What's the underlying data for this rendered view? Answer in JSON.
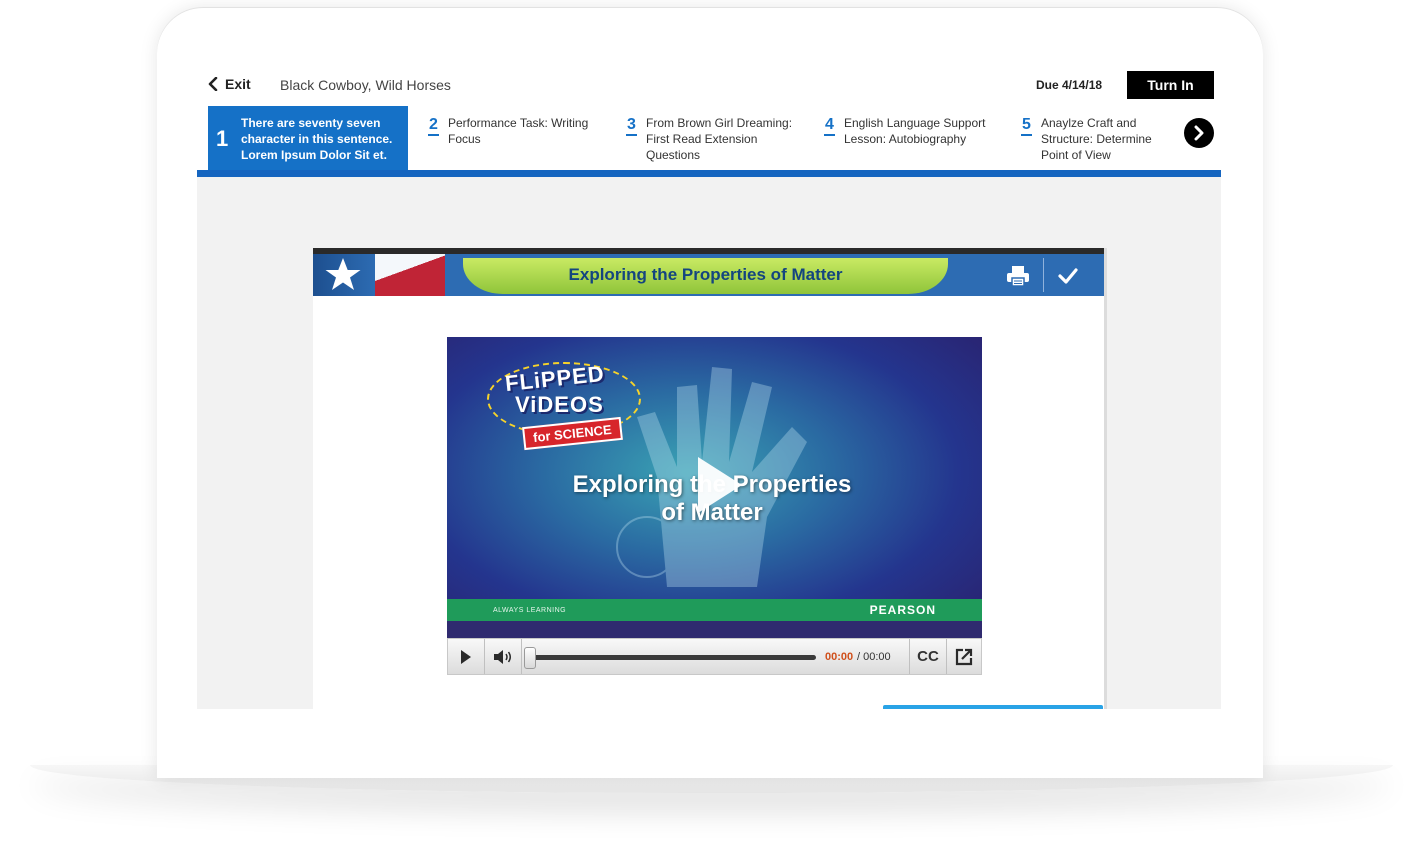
{
  "header": {
    "exit_label": "Exit",
    "lesson_title": "Black Cowboy, Wild Horses",
    "due": "Due 4/14/18",
    "turn_in_label": "Turn In"
  },
  "steps": [
    {
      "number": "1",
      "label": "There are seventy seven character in this sentence. Lorem Ipsum Dolor Sit et.",
      "active": true
    },
    {
      "number": "2",
      "label": "Performance Task: Writing Focus",
      "active": false
    },
    {
      "number": "3",
      "label": "From Brown Girl Dreaming: First Read Extension Questions",
      "active": false
    },
    {
      "number": "4",
      "label": "English Language Support Lesson: Autobiography",
      "active": false
    },
    {
      "number": "5",
      "label": "Anaylze Craft and Structure: Determine Point of View",
      "active": false
    }
  ],
  "content": {
    "banner_title": "Exploring the Properties of Matter",
    "video": {
      "logo_line1": "FLiPPED",
      "logo_line2": "ViDEOS",
      "logo_line3": "for SCIENCE",
      "title_line1": "Exploring the Properties",
      "title_line2": "of Matter",
      "footer_left": "ALWAYS LEARNING",
      "footer_right": "PEARSON"
    },
    "controls": {
      "time_current": "00:00",
      "time_total": "/ 00:00",
      "cc_label": "CC"
    }
  },
  "colors": {
    "accent_blue": "#1571c7",
    "turn_in_bg": "#000000",
    "banner_green": "#8fc43a",
    "time_orange": "#d0501c"
  },
  "icons": [
    "chevron-left-icon",
    "chevron-right-icon",
    "star-icon",
    "print-icon",
    "check-icon",
    "play-icon",
    "volume-icon",
    "cc-icon",
    "popout-icon"
  ]
}
